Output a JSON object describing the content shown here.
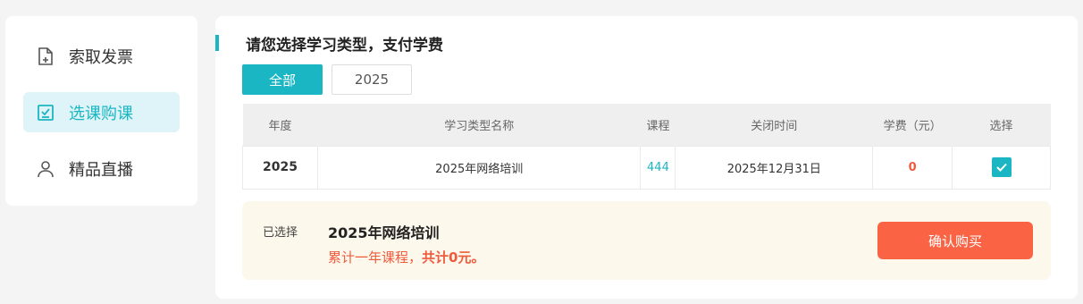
{
  "sidebar": {
    "items": [
      {
        "label": "索取发票",
        "icon": "invoice-icon"
      },
      {
        "label": "选课购课",
        "icon": "checklist-icon",
        "active": true
      },
      {
        "label": "精品直播",
        "icon": "user-icon"
      }
    ]
  },
  "main": {
    "title": "请您选择学习类型，支付学费",
    "filters": [
      "全部",
      "2025"
    ],
    "table": {
      "headers": [
        "年度",
        "学习类型名称",
        "课程",
        "关闭时间",
        "学费（元）",
        "选择"
      ],
      "rows": [
        {
          "year": "2025",
          "name": "2025年网络培训",
          "course": "444",
          "close": "2025年12月31日",
          "fee": "0",
          "selected": true
        }
      ]
    },
    "summary": {
      "label": "已选择",
      "name": "2025年网络培训",
      "desc_prefix": "累计一年课程，",
      "desc_total": "共计0元。",
      "confirm": "确认购买"
    }
  },
  "colors": {
    "accent": "#1bb6c3",
    "danger": "#fa6445",
    "fee": "#f05a3c",
    "summary_bg": "#fdf8ec"
  }
}
